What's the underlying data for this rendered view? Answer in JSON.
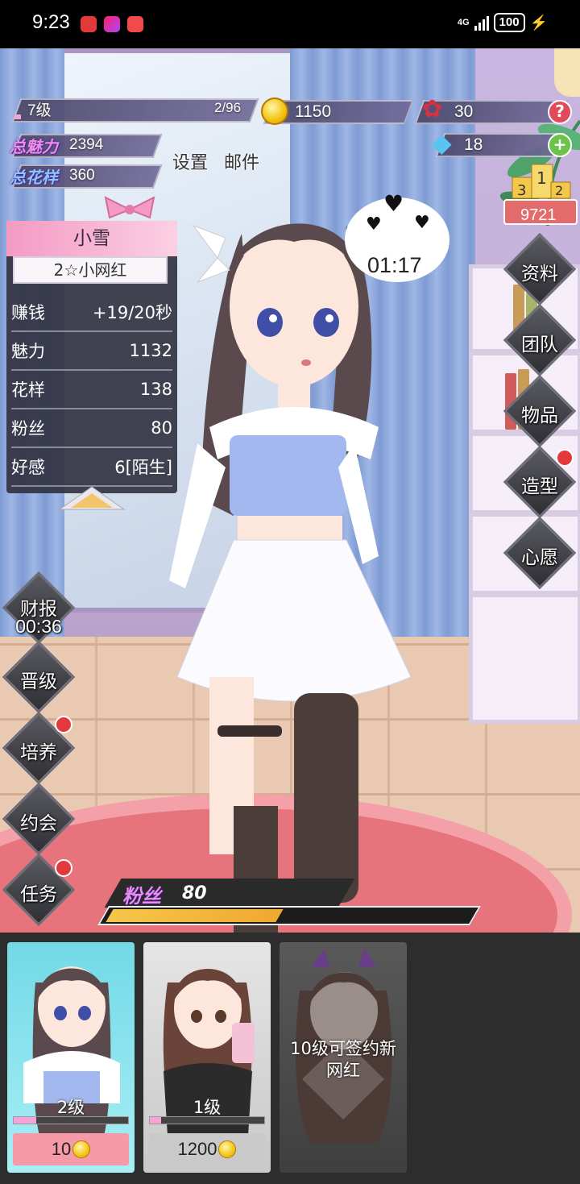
{
  "status_bar": {
    "time": "9:23",
    "network": "4G",
    "battery": "100"
  },
  "hud": {
    "level_label": "7级",
    "level_progress": "2/96",
    "level_fraction": 0.02,
    "coins": "1150",
    "roses": "30",
    "diamonds": "18",
    "help_symbol": "?",
    "add_symbol": "+",
    "total_charm_label": "总魅力",
    "total_charm_value": "2394",
    "total_style_label": "总花样",
    "total_style_value": "360",
    "settings_label": "设置",
    "mail_label": "邮件",
    "ranking_value": "9721"
  },
  "profile": {
    "name": "小雪",
    "rank": "2☆小网红",
    "stats": [
      {
        "label": "赚钱",
        "value": "+19/20秒"
      },
      {
        "label": "魅力",
        "value": "1132"
      },
      {
        "label": "花样",
        "value": "138"
      },
      {
        "label": "粉丝",
        "value": "80"
      },
      {
        "label": "好感",
        "value": "6[陌生]"
      }
    ]
  },
  "bubble": {
    "timer": "01:17"
  },
  "right_menu": [
    "资料",
    "团队",
    "物品",
    "造型",
    "心愿"
  ],
  "left_menu": {
    "finance_label": "财报",
    "finance_timer": "00:36",
    "items": [
      "晋级",
      "培养",
      "约会",
      "任务"
    ]
  },
  "fans": {
    "label": "粉丝",
    "value": "80",
    "fraction": 0.48
  },
  "cards": [
    {
      "level": "2级",
      "price": "10",
      "progress": 0.2,
      "color": "#f59aa6"
    },
    {
      "level": "1级",
      "price": "1200",
      "progress": 0.1,
      "color": "#c9c9c9"
    },
    {
      "locked_text": "10级可签约新网红"
    }
  ],
  "colors": {
    "accent_pink": "#f49ac3",
    "panel_dark": "#30303e",
    "red_dot": "#e23a3a"
  }
}
